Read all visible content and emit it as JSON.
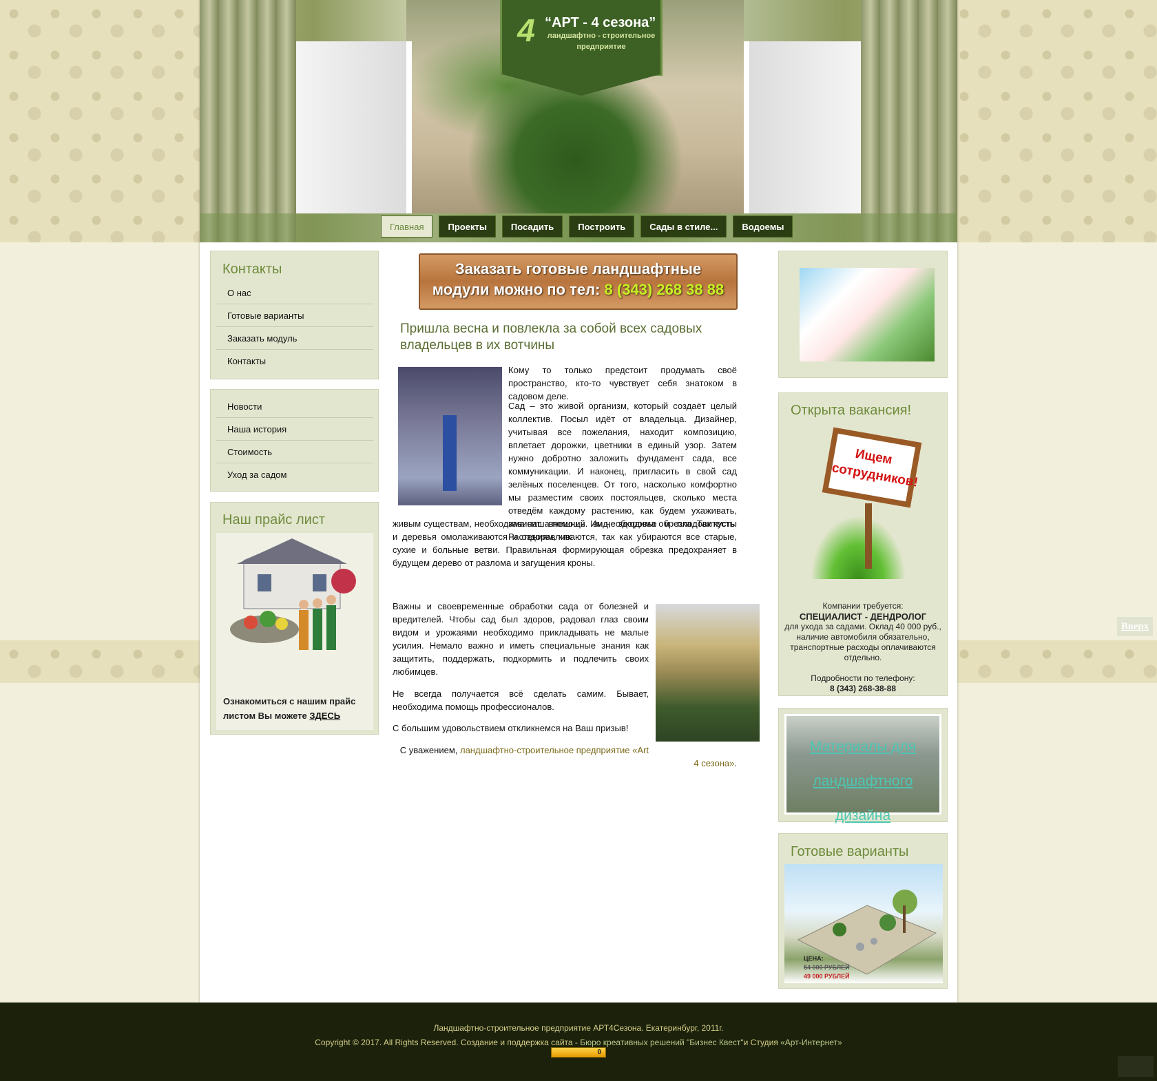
{
  "logo": {
    "title": "“АРТ - 4 сезона”",
    "subtitle": "ландшафтно - строительное предприятие",
    "mark": "4"
  },
  "nav": [
    "Главная",
    "Проекты",
    "Посадить",
    "Построить",
    "Сады в стиле...",
    "Водоемы"
  ],
  "sidebar": {
    "contacts_title": "Контакты",
    "contacts_items": [
      "О нас",
      "Готовые варианты",
      "Заказать модуль",
      "Контакты"
    ],
    "info_items": [
      "Новости",
      "Наша история",
      "Стоимость",
      "Уход за садом"
    ],
    "price": {
      "title": "Наш прайс лист",
      "text": "Ознакомиться с нашим прайс листом Вы можете ",
      "link": "ЗДЕСЬ"
    }
  },
  "banner": {
    "line1": "Заказать готовые ландшафтные",
    "line2": "модули можно по тел: ",
    "phone": "8 (343) 268 38 88"
  },
  "article": {
    "title": "Пришла весна и повлекла за собой всех садовых владельцев в их вотчины",
    "p1": "Кому то только предстоит продумать своё пространство, кто-то чувствует себя знатоком в садовом деле.",
    "p2a": "Сад – это живой организм, который создаёт целый коллектив. Посыл идёт от владельца. Дизайнер, учитывая все пожелания, находит композицию, вплетает дорожки, цветники в единый узор. Затем нужно добротно заложить фундамент сада, все коммуникации. И наконец, пригласить в свой сад зелёных поселенцев. От того, насколько комфортно мы разместим своих постояльцев, сколько места отведём каждому растению, как будем ухаживать, зависит внешний вид, здоровье и плодовитость. Растениям, как",
    "p2b": "живым существам, необходима наша помощь. Им необходима обрезка. Так кусты и деревья омолаживаются и оздоравливаются, так как убираются все старые, сухие и больные ветви. Правильная формирующая обрезка предохраняет в будущем дерево от разлома и загущения кроны.",
    "p3": "Важны и своевременные обработки сада от болезней и вредителей. Чтобы сад был здоров, радовал глаз своим видом и урожаями необходимо прикладывать не малые усилия. Немало важно и иметь специальные знания как защитить, поддержать, подкормить и подлечить своих любимцев.",
    "p4": "Не всегда получается всё сделать самим. Бывает, необходима помощь профессионалов.",
    "p5": "С большим удовольствием откликнемся на Ваш призыв!",
    "sign_prefix": "С уважением, ",
    "sign_link1": "ландшафтно-строительное предприятие «Art",
    "sign_link2": "4 сезона»",
    "sign_end": "."
  },
  "right": {
    "vacancy_title": "Открыта вакансия!",
    "vacancy_sign": "Ищем сотрудников!",
    "vacancy_l1": "Компании требуется:",
    "vacancy_l2": "СПЕЦИАЛИСТ - ДЕНДРОЛОГ",
    "vacancy_l3": "для ухода за садами. Оклад 40 000 руб., наличие автомобиля обязательно, транспортные расходы оплачиваются отдельно.",
    "vacancy_l4": "Подробности по телефону:",
    "vacancy_phone": "8 (343) 268-38-88",
    "materials": "Материалы для ландшафтного дизайна",
    "ready_title": "Готовые варианты",
    "ready_price_label": "ЦЕНА:",
    "ready_old": "54 000 РУБЛЕЙ",
    "ready_new": "49 000 РУБЛЕЙ"
  },
  "footer": {
    "line1": "Ландшафтно-строительное предприятие АРТ4Сезона. Екатеринбург, 2011г.",
    "line2": "Copyright © 2017. All Rights Reserved. Создание и поддержка сайта - ",
    "link1": "Бюро креативных решений \"Бизнес Квест\"",
    "and": "и Студия ",
    "link2": "«Арт-Интернет»",
    "counter": "0"
  },
  "up_button": "Вверх"
}
